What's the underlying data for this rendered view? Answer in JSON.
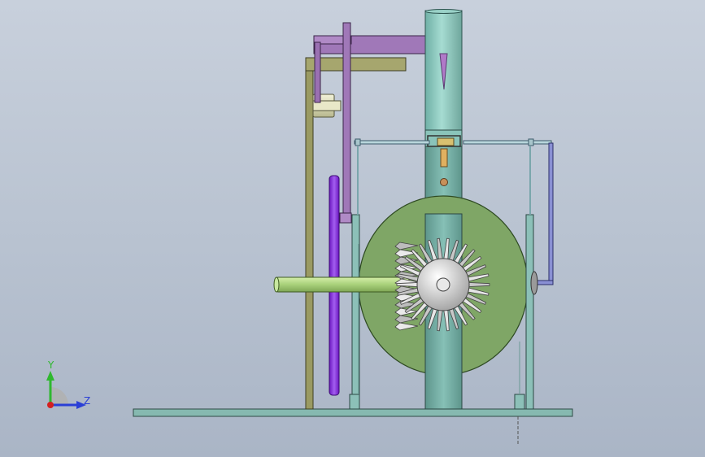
{
  "viewport": {
    "background_top": "#c8d0dc",
    "background_bottom": "#aab5c6"
  },
  "triad": {
    "y_label": "Y",
    "z_label": "Z",
    "y_color": "#2fb82f",
    "z_color": "#2a3fd6",
    "x_color": "#d42020"
  },
  "model": {
    "part_colors": {
      "base_plate": "#86b9b0",
      "column": "#6aa39a",
      "frame_tan": "#9a9a62",
      "lever_purple": "#a078b8",
      "pulley_violet": "#8a2ee0",
      "disc_green": "#7fa666",
      "shaft": "#a8d07a",
      "gear": "#d6d6d6",
      "rod_blue": "#7a80c8"
    }
  }
}
